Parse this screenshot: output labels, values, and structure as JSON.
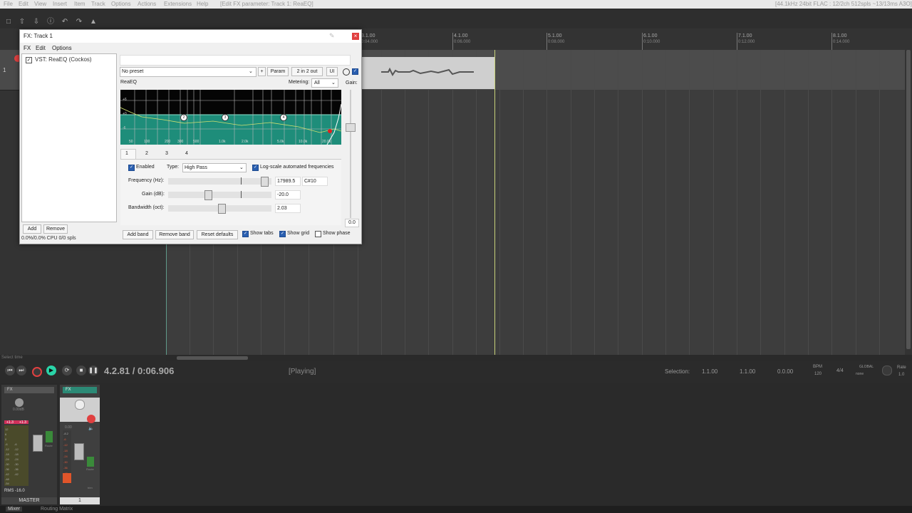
{
  "menubar": {
    "items": [
      "File",
      "Edit",
      "View",
      "Insert",
      "Item",
      "Track",
      "Options",
      "Actions",
      "Extensions",
      "Help"
    ],
    "status": "[Edit FX parameter: Track 1: ReaEQ]",
    "audio_info": "[44.1kHz 24bit FLAC : 12/2ch 512spls ~13/13ms A3O]"
  },
  "ruler": {
    "marks": [
      {
        "label": "3.1.00",
        "sub": "0:04.000"
      },
      {
        "label": "4.1.00",
        "sub": "0:06.000"
      },
      {
        "label": "5.1.00",
        "sub": "0:08.000"
      },
      {
        "label": "6.1.00",
        "sub": "0:10.000"
      },
      {
        "label": "7.1.00",
        "sub": "0:12.000"
      },
      {
        "label": "8.1.00",
        "sub": "0:14.000"
      }
    ]
  },
  "track": {
    "number": "1"
  },
  "transport": {
    "position": "4.2.81 / 0:06.906",
    "state": "[Playing]",
    "selection_label": "Selection:",
    "selection_start": "1.1.00",
    "selection_end": "1.1.00",
    "selection_length": "0.0.00",
    "bpm_label": "BPM",
    "bpm": "120",
    "timesig": "4/4",
    "global_label": "GLOBAL",
    "global_value": "none",
    "rate_label": "Rate",
    "rate": "1.0",
    "select_time": "Select time"
  },
  "mixer": {
    "master_label": "MASTER",
    "master_volume": "0.00dB",
    "rms": "RMS -16.0",
    "track_num": "1",
    "track_volume": "0.00",
    "tabs": [
      "Mixer",
      "Routing Matrix"
    ],
    "fx_label": "FX",
    "route_label": "Route",
    "trim_label": "trim",
    "master_peak_l": "+1.3",
    "master_peak_r": "+1.3",
    "master_scale": [
      "12",
      "6",
      "0",
      "-6",
      "-12",
      "-18",
      "-24",
      "-30",
      "-36",
      "-42",
      "-48",
      "-54"
    ],
    "master_scale_right": [
      "-6",
      "-12",
      "-18",
      "-24",
      "-30",
      "-36",
      "-42"
    ],
    "track_scale": [
      "-8.2",
      "-6",
      "-12",
      "-18",
      "-24",
      "-30",
      "-36",
      "-42"
    ]
  },
  "fx_window": {
    "title": "FX: Track 1",
    "menu": [
      "FX",
      "Edit",
      "Options"
    ],
    "plugin": "VST: ReaEQ (Cockos)",
    "add_label": "Add",
    "remove_label": "Remove",
    "cpu": "0.0%/0.0% CPU 0/0 spls",
    "preset": "No preset",
    "plus": "+",
    "param_label": "Param",
    "io_label": "2 in 2 out",
    "ui_label": "UI",
    "plugin_name": "ReaEQ",
    "metering_label": "Metering:",
    "metering_value": "All",
    "gain_label": "Gain:",
    "gain_value": "0.0",
    "tabs": [
      "1",
      "2",
      "3",
      "4"
    ],
    "graph_db_labels": [
      "+6",
      "+0",
      "-6"
    ],
    "graph_freq_labels": [
      "50",
      "100",
      "200",
      "300",
      "500",
      "1.0k",
      "2.0k",
      "5.0k",
      "10.0k",
      "20.0k"
    ],
    "band": {
      "enabled_label": "Enabled",
      "type_label": "Type:",
      "type_value": "High Pass",
      "log_label": "Log-scale automated frequencies",
      "freq_label": "Frequency (Hz):",
      "freq_value": "17989.5",
      "note_value": "C#10",
      "gain_label": "Gain (dB):",
      "gain_value": "-20.0",
      "bw_label": "Bandwidth (oct):",
      "bw_value": "2.03",
      "freq_level": 0.95,
      "gain_level": 0.37,
      "bw_level": 0.5
    },
    "footer": {
      "add_band": "Add band",
      "remove_band": "Remove band",
      "reset": "Reset defaults",
      "show_tabs": "Show tabs",
      "show_grid": "Show grid",
      "show_phase": "Show phase"
    },
    "eq_nodes": [
      "2",
      "3",
      "4"
    ]
  },
  "colors": {
    "eq_fill": "#1e8d7a",
    "checkbox": "#2a5fb0",
    "record": "#e04040",
    "play": "#2ad4a8"
  }
}
